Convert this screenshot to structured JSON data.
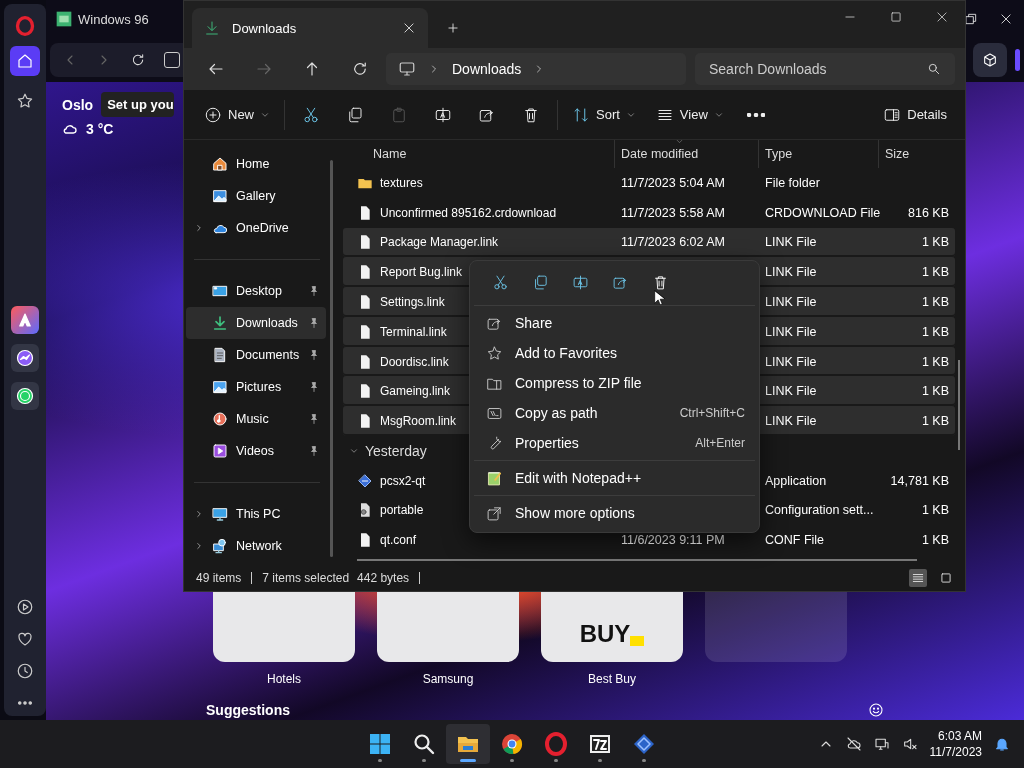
{
  "browser": {
    "tab_title": "Windows 96",
    "opera_sidebar": [
      {
        "kind": "home",
        "selected": true
      },
      {
        "kind": "favorites",
        "selected": false
      }
    ],
    "weather": {
      "city": "Oslo",
      "prompt": "Set up you",
      "temperature": "3 °C"
    },
    "speed_dial": [
      {
        "kind": "site",
        "label": "Hotels"
      },
      {
        "kind": "site",
        "label": "Samsung"
      },
      {
        "kind": "site",
        "label": "Best Buy",
        "logo": "BUY"
      },
      {
        "kind": "empty"
      }
    ],
    "suggestions_heading": "Suggestions"
  },
  "explorer": {
    "tab": {
      "title": "Downloads"
    },
    "nav_buttons": [
      {
        "kind": "back",
        "disabled": false
      },
      {
        "kind": "forward",
        "disabled": true
      },
      {
        "kind": "up",
        "disabled": false
      },
      {
        "kind": "refresh",
        "disabled": false
      }
    ],
    "breadcrumb": [
      "Downloads"
    ],
    "search": {
      "placeholder": "Search Downloads"
    },
    "toolbar": [
      {
        "kind": "new",
        "label": "New",
        "dropdown": true,
        "disabled": false
      },
      {
        "kind": "cut",
        "disabled": false
      },
      {
        "kind": "copy",
        "disabled": false
      },
      {
        "kind": "paste",
        "disabled": true
      },
      {
        "kind": "rename",
        "disabled": false
      },
      {
        "kind": "share",
        "disabled": false
      },
      {
        "kind": "delete",
        "disabled": false
      },
      {
        "kind": "sort",
        "label": "Sort",
        "dropdown": true,
        "disabled": false
      },
      {
        "kind": "view",
        "label": "View",
        "dropdown": true,
        "disabled": false
      },
      {
        "kind": "more",
        "disabled": false
      }
    ],
    "details_button": {
      "label": "Details"
    },
    "nav_groups": [
      [
        {
          "label": "Home",
          "selected": false,
          "pinned": false,
          "expandable": false
        },
        {
          "label": "Gallery",
          "selected": false,
          "pinned": false,
          "expandable": false
        },
        {
          "label": "OneDrive",
          "selected": false,
          "pinned": false,
          "expandable": true
        }
      ],
      [
        {
          "label": "Desktop",
          "selected": false,
          "pinned": true,
          "expandable": false
        },
        {
          "label": "Downloads",
          "selected": true,
          "pinned": true,
          "expandable": false
        },
        {
          "label": "Documents",
          "selected": false,
          "pinned": true,
          "expandable": false
        },
        {
          "label": "Pictures",
          "selected": false,
          "pinned": true,
          "expandable": false
        },
        {
          "label": "Music",
          "selected": false,
          "pinned": true,
          "expandable": false
        },
        {
          "label": "Videos",
          "selected": false,
          "pinned": true,
          "expandable": false
        }
      ],
      [
        {
          "label": "This PC",
          "selected": false,
          "pinned": false,
          "expandable": true
        },
        {
          "label": "Network",
          "selected": false,
          "pinned": false,
          "expandable": true
        }
      ]
    ],
    "columns": [
      {
        "label": "Name",
        "sorted": false
      },
      {
        "label": "Date modified",
        "sorted": true
      },
      {
        "label": "Type",
        "sorted": false
      },
      {
        "label": "Size",
        "sorted": false
      }
    ],
    "rows": [
      {
        "kind": "folder",
        "name": "textures",
        "date": "11/7/2023 5:04 AM",
        "type": "File folder",
        "selected": false
      },
      {
        "kind": "file",
        "name": "Unconfirmed 895162.crdownload",
        "date": "11/7/2023 5:58 AM",
        "type": "CRDOWNLOAD File",
        "size": "816 KB",
        "selected": false
      },
      {
        "kind": "file",
        "name": "Package Manager.link",
        "date": "11/7/2023 6:02 AM",
        "type": "LINK File",
        "size": "1 KB",
        "selected": true
      },
      {
        "kind": "file",
        "name": "Report Bug.link",
        "type": "LINK File",
        "size": "1 KB",
        "selected": true
      },
      {
        "kind": "file",
        "name": "Settings.link",
        "type": "LINK File",
        "size": "1 KB",
        "selected": true
      },
      {
        "kind": "file",
        "name": "Terminal.link",
        "type": "LINK File",
        "size": "1 KB",
        "selected": true
      },
      {
        "kind": "file",
        "name": "Doordisc.link",
        "type": "LINK File",
        "size": "1 KB",
        "selected": true
      },
      {
        "kind": "file",
        "name": "Gameing.link",
        "type": "LINK File",
        "size": "1 KB",
        "selected": true
      },
      {
        "kind": "file",
        "name": "MsgRoom.link",
        "type": "LINK File",
        "size": "1 KB",
        "selected": true
      },
      {
        "kind": "group",
        "name": "Yesterday",
        "expanded": true
      },
      {
        "kind": "app",
        "name": "pcsx2-qt",
        "type": "Application",
        "size": "14,781 KB",
        "selected": false
      },
      {
        "kind": "config",
        "name": "portable",
        "type": "Configuration sett...",
        "size": "1 KB",
        "selected": false
      },
      {
        "kind": "file",
        "name": "qt.conf",
        "date": "11/6/2023 9:11 PM",
        "type": "CONF File",
        "size": "1 KB",
        "selected": false
      }
    ],
    "status": {
      "count": "49 items",
      "selection": "7 items selected",
      "size": "442 bytes"
    },
    "view_modes": [
      {
        "kind": "details",
        "selected": true
      },
      {
        "kind": "tiles",
        "selected": false
      }
    ],
    "context_menu": {
      "quick_actions": [
        {
          "kind": "cut"
        },
        {
          "kind": "copy"
        },
        {
          "kind": "rename"
        },
        {
          "kind": "share"
        },
        {
          "kind": "delete"
        }
      ],
      "groups": [
        [
          {
            "kind": "share",
            "label": "Share"
          },
          {
            "kind": "star",
            "label": "Add to Favorites"
          },
          {
            "kind": "zip",
            "label": "Compress to ZIP file"
          },
          {
            "kind": "path",
            "label": "Copy as path",
            "shortcut": "Ctrl+Shift+C"
          },
          {
            "kind": "wrench",
            "label": "Properties",
            "shortcut": "Alt+Enter"
          }
        ],
        [
          {
            "kind": "notepad",
            "label": "Edit with Notepad++"
          }
        ],
        [
          {
            "kind": "external",
            "label": "Show more options"
          }
        ]
      ]
    }
  },
  "taskbar": {
    "apps": [
      {
        "kind": "start",
        "active": false
      },
      {
        "kind": "search",
        "active": false
      },
      {
        "kind": "explorer",
        "active": true
      },
      {
        "kind": "chrome",
        "active": false
      },
      {
        "kind": "opera",
        "active": false
      },
      {
        "kind": "sevenzip",
        "active": false
      },
      {
        "kind": "pcsx2",
        "active": false
      }
    ],
    "time": "6:03 AM",
    "date": "11/7/2023"
  }
}
